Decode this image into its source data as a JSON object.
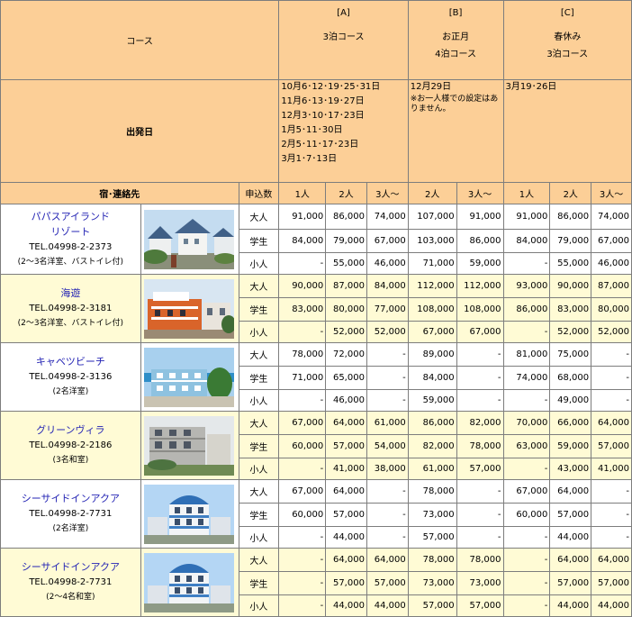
{
  "header": {
    "course_label": "コース",
    "departure_label": "出発日",
    "lodging_label": "宿･連絡先",
    "application_label": "申込数",
    "courses": [
      {
        "letter": "[A]",
        "name_lines": [
          "3泊コース"
        ]
      },
      {
        "letter": "[B]",
        "name_lines": [
          "お正月",
          "4泊コース"
        ]
      },
      {
        "letter": "[C]",
        "name_lines": [
          "春休み",
          "3泊コース"
        ]
      }
    ],
    "dates_a": [
      "10月6･12･19･25･31日",
      "11月6･13･19･27日",
      "12月3･10･17･23日",
      "1月5･11･30日",
      "2月5･11･17･23日",
      "3月1･7･13日"
    ],
    "dates_b": "12月29日",
    "dates_b_note": "※お一人様での設定はありません。",
    "dates_c": "3月19･26日",
    "people_headers": [
      "1人",
      "2人",
      "3人〜",
      "2人",
      "3人〜",
      "1人",
      "2人",
      "3人〜"
    ]
  },
  "categories": [
    "大人",
    "学生",
    "小人"
  ],
  "hotels": [
    {
      "name_lines": [
        "パパスアイランド",
        "リゾート"
      ],
      "tel": "TEL.04998-2-2373",
      "note": "(2〜3名洋室、バストイレ付)",
      "photo": "photo-white-houses",
      "rows": [
        [
          "91,000",
          "86,000",
          "74,000",
          "107,000",
          "91,000",
          "91,000",
          "86,000",
          "74,000"
        ],
        [
          "84,000",
          "79,000",
          "67,000",
          "103,000",
          "86,000",
          "84,000",
          "79,000",
          "67,000"
        ],
        [
          "-",
          "55,000",
          "46,000",
          "71,000",
          "59,000",
          "-",
          "55,000",
          "46,000"
        ]
      ]
    },
    {
      "name_lines": [
        "海遊"
      ],
      "tel": "TEL.04998-2-3181",
      "note": "(2〜3名洋室、バストイレ付)",
      "photo": "photo-orange-building",
      "rows": [
        [
          "90,000",
          "87,000",
          "84,000",
          "112,000",
          "112,000",
          "93,000",
          "90,000",
          "87,000"
        ],
        [
          "83,000",
          "80,000",
          "77,000",
          "108,000",
          "108,000",
          "86,000",
          "83,000",
          "80,000"
        ],
        [
          "-",
          "52,000",
          "52,000",
          "67,000",
          "67,000",
          "-",
          "52,000",
          "52,000"
        ]
      ]
    },
    {
      "name_lines": [
        "キャベツビーチ"
      ],
      "tel": "TEL.04998-2-3136",
      "note": "(2名洋室)",
      "photo": "photo-blue-building",
      "rows": [
        [
          "78,000",
          "72,000",
          "-",
          "89,000",
          "-",
          "81,000",
          "75,000",
          "-"
        ],
        [
          "71,000",
          "65,000",
          "-",
          "84,000",
          "-",
          "74,000",
          "68,000",
          "-"
        ],
        [
          "-",
          "46,000",
          "-",
          "59,000",
          "-",
          "-",
          "49,000",
          "-"
        ]
      ]
    },
    {
      "name_lines": [
        "グリーンヴィラ"
      ],
      "tel": "TEL.04998-2-2186",
      "note": "(3名和室)",
      "photo": "photo-grey-building",
      "rows": [
        [
          "67,000",
          "64,000",
          "61,000",
          "86,000",
          "82,000",
          "70,000",
          "66,000",
          "64,000"
        ],
        [
          "60,000",
          "57,000",
          "54,000",
          "82,000",
          "78,000",
          "63,000",
          "59,000",
          "57,000"
        ],
        [
          "-",
          "41,000",
          "38,000",
          "61,000",
          "57,000",
          "-",
          "43,000",
          "41,000"
        ]
      ]
    },
    {
      "name_lines": [
        "シーサイドインアクア"
      ],
      "tel": "TEL.04998-2-7731",
      "note": "(2名洋室)",
      "photo": "photo-aqua-building",
      "rows": [
        [
          "67,000",
          "64,000",
          "-",
          "78,000",
          "-",
          "67,000",
          "64,000",
          "-"
        ],
        [
          "60,000",
          "57,000",
          "-",
          "73,000",
          "-",
          "60,000",
          "57,000",
          "-"
        ],
        [
          "-",
          "44,000",
          "-",
          "57,000",
          "-",
          "-",
          "44,000",
          "-"
        ]
      ]
    },
    {
      "name_lines": [
        "シーサイドインアクア"
      ],
      "tel": "TEL.04998-2-7731",
      "note": "(2〜4名和室)",
      "photo": "photo-aqua-building",
      "rows": [
        [
          "-",
          "64,000",
          "64,000",
          "78,000",
          "78,000",
          "-",
          "64,000",
          "64,000"
        ],
        [
          "-",
          "57,000",
          "57,000",
          "73,000",
          "73,000",
          "-",
          "57,000",
          "57,000"
        ],
        [
          "-",
          "44,000",
          "44,000",
          "57,000",
          "57,000",
          "-",
          "44,000",
          "44,000"
        ]
      ]
    }
  ],
  "colors": {
    "header_bg": "#fccf97",
    "accent_red": "#cc0000",
    "hotel_link": "#2424b4",
    "row_white": "#ffffff",
    "row_yellow": "#fffbd5",
    "grid_line": "#7d7d7d"
  }
}
